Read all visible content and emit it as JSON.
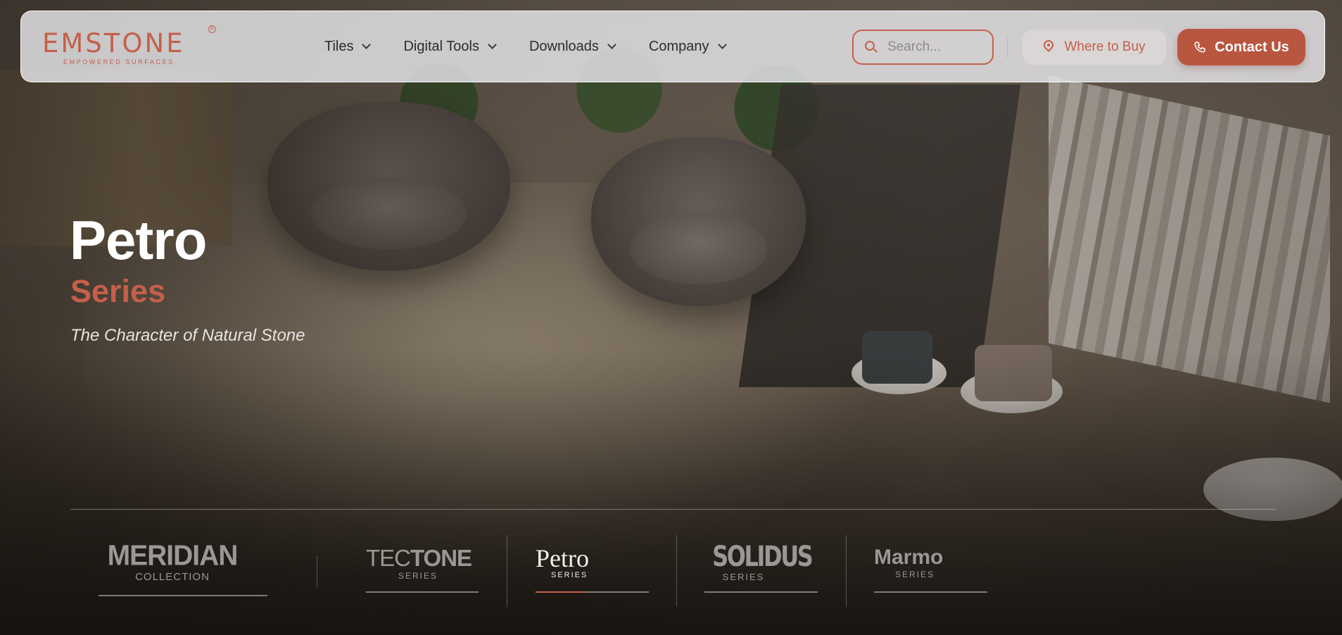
{
  "brand": {
    "logo_text": "EMSTONE",
    "tagline": "EMPOWERED SURFACES",
    "registered_mark": "R",
    "accent_color": "#c4604a"
  },
  "nav": {
    "items": [
      {
        "label": "Tiles",
        "icon": "chevron-down-icon"
      },
      {
        "label": "Digital Tools",
        "icon": "chevron-down-icon"
      },
      {
        "label": "Downloads",
        "icon": "chevron-down-icon"
      },
      {
        "label": "Company",
        "icon": "chevron-down-icon"
      }
    ]
  },
  "search": {
    "placeholder": "Search...",
    "value": "",
    "icon": "search-icon"
  },
  "actions": {
    "where_to_buy": {
      "label": "Where to Buy",
      "icon": "map-pin-icon"
    },
    "contact": {
      "label": "Contact Us",
      "icon": "phone-icon",
      "color": "#b95640"
    }
  },
  "hero": {
    "title": "Petro",
    "subtitle": "Series",
    "tagline": "The Character of Natural Stone"
  },
  "collections": [
    {
      "name": "MERIDIAN",
      "sub": "COLLECTION",
      "active": false
    },
    {
      "name_light": "TEC",
      "name_bold": "TONE",
      "sub": "SERIES",
      "active": false
    },
    {
      "name": "Petro",
      "sub": "SERIES",
      "active": true
    },
    {
      "name": "SOLIDUS",
      "sub": "SERIES",
      "active": false
    },
    {
      "name": "Marmo",
      "sub": "SERIES",
      "active": false
    }
  ]
}
